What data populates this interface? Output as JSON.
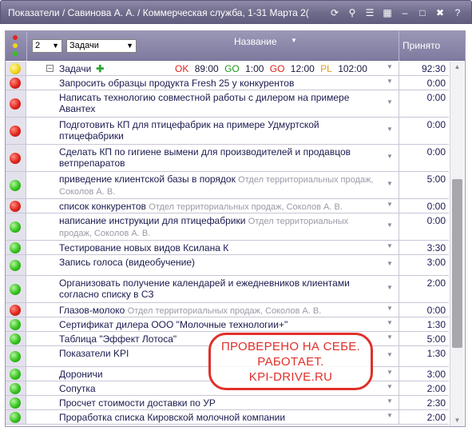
{
  "window": {
    "title": "Показатели / Савинова А. А. / Коммерческая служба, 1-31 Марта 2(",
    "icons": [
      "refresh-icon",
      "search-icon",
      "list-icon",
      "calendar-icon",
      "minimize-icon",
      "restore-icon",
      "close-icon",
      "help-icon"
    ]
  },
  "header": {
    "count_value": "2",
    "view_value": "Задачи",
    "name_label": "Название",
    "accepted_label": "Принято"
  },
  "summary": {
    "label": "Задачи",
    "ok_label": "OK",
    "ok_value": "89:00",
    "go1_label": "GO",
    "go1_value": "1:00",
    "go2_label": "GO",
    "go2_value": "12:00",
    "pl_label": "PL",
    "pl_value": "102:00",
    "accepted": "92:30",
    "status": "yellow"
  },
  "tasks": [
    {
      "title": "Запросить образцы продукта Fresh 25 у конкурентов",
      "dept": "",
      "accepted": "0:00",
      "status": "red"
    },
    {
      "title": "Написать технологию совместной работы с дилером на примере Авантех",
      "dept": "",
      "accepted": "0:00",
      "status": "red"
    },
    {
      "title": "Подготовить КП для птицефабрик на примере Удмуртской птицефабрики",
      "dept": "",
      "accepted": "0:00",
      "status": "red"
    },
    {
      "title": "Сделать КП по гигиене вымени для производителей и продавцов ветпрепаратов",
      "dept": "",
      "accepted": "0:00",
      "status": "red"
    },
    {
      "title": "приведение клиентской базы в порядок",
      "dept": "Отдел территориальных продаж, Соколов А. В.",
      "accepted": "5:00",
      "status": "green"
    },
    {
      "title": "список конкурентов",
      "dept": "Отдел территориальных продаж, Соколов А. В.",
      "accepted": "0:00",
      "status": "red"
    },
    {
      "title": "написание инструкции для птицефабрики",
      "dept": "Отдел территориальных продаж, Соколов А. В.",
      "accepted": "0:00",
      "status": "green"
    },
    {
      "title": "Тестирование новых видов Ксилана К",
      "dept": "",
      "accepted": "3:30",
      "status": "green"
    },
    {
      "title": "Запись голоса (видеобучение)",
      "dept": "",
      "accepted": "3:00",
      "status": "green"
    },
    {
      "title": "Организовать получение календарей и ежедневников клиентами согласно списку в СЗ",
      "dept": "",
      "accepted": "2:00",
      "status": "green"
    },
    {
      "title": "Глазов-молоко",
      "dept": "Отдел территориальных продаж, Соколов А. В.",
      "accepted": "0:00",
      "status": "red"
    },
    {
      "title": "Сертификат дилера ООО \"Молочные технологии+\"",
      "dept": "",
      "accepted": "1:30",
      "status": "green"
    },
    {
      "title": "Таблица \"Эффект Лотоса\"",
      "dept": "",
      "accepted": "5:00",
      "status": "green"
    },
    {
      "title": "Показатели KPI",
      "dept": "",
      "accepted": "1:30",
      "status": "green"
    },
    {
      "title": "Дороничи",
      "dept": "",
      "accepted": "3:00",
      "status": "green"
    },
    {
      "title": "Сопутка",
      "dept": "",
      "accepted": "2:00",
      "status": "green"
    },
    {
      "title": "Просчет стоимости доставки по УР",
      "dept": "",
      "accepted": "2:30",
      "status": "green"
    },
    {
      "title": "Проработка списка Кировской молочной компании",
      "dept": "",
      "accepted": "2:00",
      "status": "green"
    }
  ],
  "stamp": {
    "line1": "ПРОВЕРЕНО НА СЕБЕ.",
    "line2": "РАБОТАЕТ.",
    "line3": "KPI-DRIVE.RU"
  },
  "scrollbar": {
    "thumb_position": 0.62,
    "thumb_fraction": 0.5
  }
}
